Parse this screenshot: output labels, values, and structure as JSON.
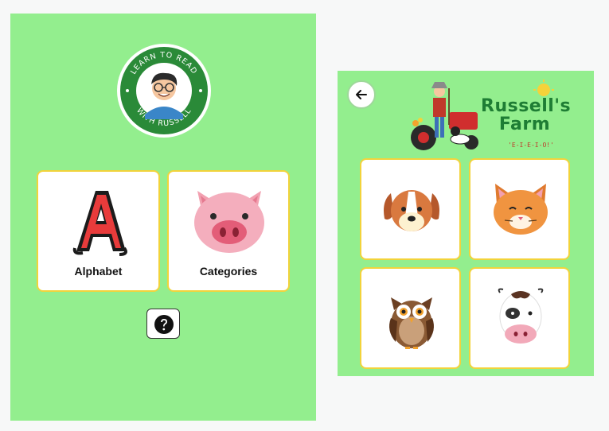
{
  "home": {
    "logo_text_top": "LEARN TO READ",
    "logo_text_bottom": "WITH RUSSELL",
    "cards": [
      {
        "label": "Alphabet"
      },
      {
        "label": "Categories"
      }
    ],
    "help_icon": "question-circle-icon"
  },
  "farm": {
    "back_icon": "arrow-left-icon",
    "title_line1": "Russell's",
    "title_line2": "Farm",
    "subtitle": "'E-I-E-I-O!'",
    "animals": [
      "dog",
      "cat",
      "owl",
      "cow"
    ]
  },
  "colors": {
    "panel_green": "#93ee8e",
    "card_border": "#f2d33b",
    "logo_green": "#2a8a38"
  }
}
